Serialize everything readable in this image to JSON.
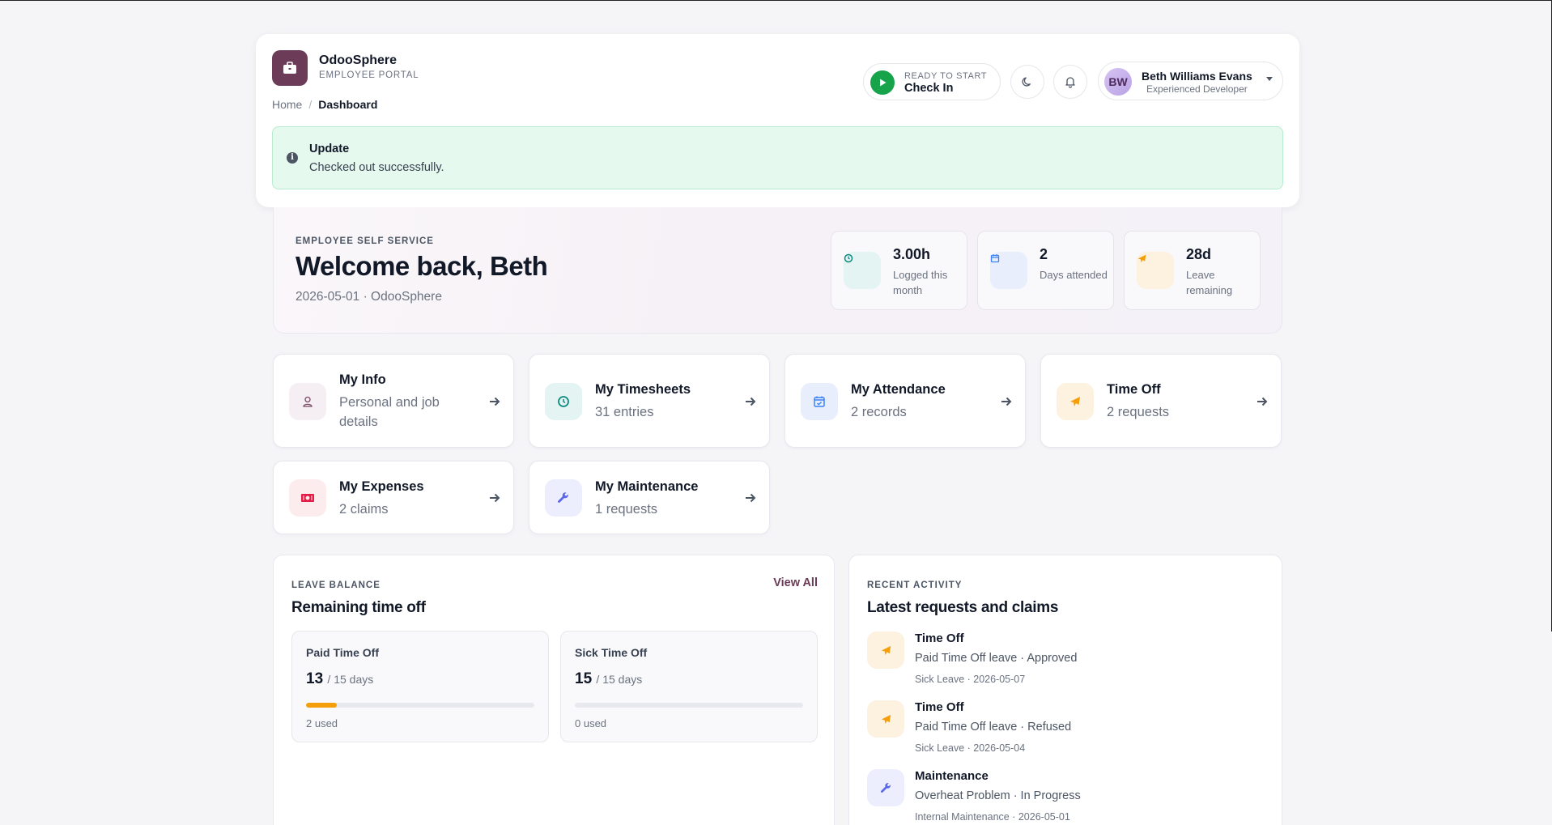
{
  "brand": {
    "name": "OdooSphere",
    "subtitle": "EMPLOYEE PORTAL"
  },
  "breadcrumb": {
    "home": "Home",
    "separator": "/",
    "current": "Dashboard"
  },
  "checkin": {
    "status": "READY TO START",
    "label": "Check In"
  },
  "user": {
    "initials": "BW",
    "name": "Beth Williams Evans",
    "role": "Experienced Developer"
  },
  "alert": {
    "title": "Update",
    "message": "Checked out successfully."
  },
  "welcome": {
    "eyebrow": "EMPLOYEE SELF SERVICE",
    "title": "Welcome back, Beth",
    "subtitle": "2026-05-01 · OdooSphere"
  },
  "stats": [
    {
      "value": "3.00h",
      "label": "Logged this month",
      "icon": "clock-icon",
      "color": "#0f8a80",
      "bg": "#e3f4f3"
    },
    {
      "value": "2",
      "label": "Days attended",
      "icon": "calendar-icon",
      "color": "#3b82f6",
      "bg": "#e8eefb"
    },
    {
      "value": "28d",
      "label": "Leave remaining",
      "icon": "plane-icon",
      "color": "#f59e0b",
      "bg": "#fdf1e0"
    }
  ],
  "quick_links": [
    {
      "title": "My Info",
      "subtitle": "Personal and job details",
      "icon": "user-icon"
    },
    {
      "title": "My Timesheets",
      "subtitle": "31 entries",
      "icon": "clock-icon"
    },
    {
      "title": "My Attendance",
      "subtitle": "2 records",
      "icon": "calendar-check-icon"
    },
    {
      "title": "Time Off",
      "subtitle": "2 requests",
      "icon": "plane-icon"
    },
    {
      "title": "My Expenses",
      "subtitle": "2 claims",
      "icon": "money-icon"
    },
    {
      "title": "My Maintenance",
      "subtitle": "1 requests",
      "icon": "wrench-icon"
    }
  ],
  "leave_balance": {
    "eyebrow": "LEAVE BALANCE",
    "title": "Remaining time off",
    "view_all": "View All",
    "items": [
      {
        "name": "Paid Time Off",
        "remaining": "13",
        "total": "/ 15 days",
        "used": "2 used",
        "used_fraction": 0.133
      },
      {
        "name": "Sick Time Off",
        "remaining": "15",
        "total": "/ 15 days",
        "used": "0 used",
        "used_fraction": 0
      }
    ]
  },
  "recent_activity": {
    "eyebrow": "RECENT ACTIVITY",
    "title": "Latest requests and claims",
    "items": [
      {
        "title": "Time Off",
        "description": "Paid Time Off leave · Approved",
        "meta": "Sick Leave · 2026-05-07",
        "icon": "plane-icon"
      },
      {
        "title": "Time Off",
        "description": "Paid Time Off leave · Refused",
        "meta": "Sick Leave · 2026-05-04",
        "icon": "plane-icon"
      },
      {
        "title": "Maintenance",
        "description": "Overheat Problem · In Progress",
        "meta": "Internal Maintenance · 2026-05-01",
        "icon": "wrench-icon"
      }
    ]
  }
}
